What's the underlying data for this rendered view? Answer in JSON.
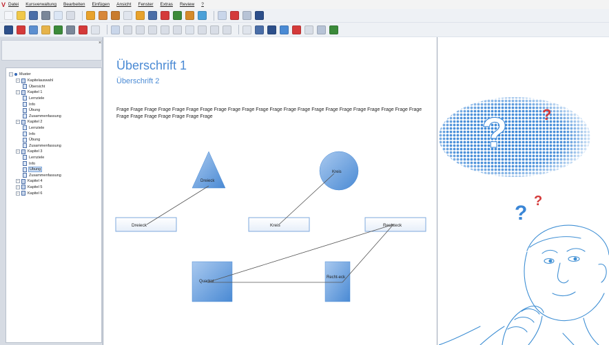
{
  "menu": {
    "logo": "V",
    "items": [
      "Datei",
      "Kursverwaltung",
      "Bearbeiten",
      "Einfügen",
      "Ansicht",
      "Fenster",
      "Extras",
      "Review",
      "?"
    ]
  },
  "toolbar": {
    "row1": [
      {
        "icon": "new-doc-icon",
        "color": "#f4f6fa"
      },
      {
        "icon": "open-folder-icon",
        "color": "#f0c84a"
      },
      {
        "icon": "save-icon",
        "color": "#4a6ea8"
      },
      {
        "icon": "print-icon",
        "color": "#7a8799"
      },
      {
        "icon": "copy-icon",
        "color": "#dbe6f5"
      },
      {
        "icon": "paste-icon",
        "color": "#d8dde6"
      },
      {
        "icon": "sep"
      },
      {
        "icon": "page-icon",
        "color": "#e8a22c"
      },
      {
        "icon": "page-edit-icon",
        "color": "#d7873a"
      },
      {
        "icon": "page-settings-icon",
        "color": "#c87b2e"
      },
      {
        "icon": "page-link-icon",
        "color": "#e0e5ee"
      },
      {
        "icon": "page-new-icon",
        "color": "#e8a22c"
      },
      {
        "icon": "page-save-icon",
        "color": "#4a6ea8"
      },
      {
        "icon": "page-delete-icon",
        "color": "#d43a3a"
      },
      {
        "icon": "page-export-icon",
        "color": "#3b8a3a"
      },
      {
        "icon": "page-move-icon",
        "color": "#d58a2a"
      },
      {
        "icon": "page-import-icon",
        "color": "#4aa0d8"
      },
      {
        "icon": "sep"
      },
      {
        "icon": "align-left-icon",
        "color": "#c9d6ea"
      },
      {
        "icon": "align-top-icon",
        "color": "#d43a3a"
      },
      {
        "icon": "width-icon",
        "color": "#b7c3d6"
      },
      {
        "icon": "text-cursor-icon",
        "color": "#2c4f8a"
      }
    ],
    "row2": [
      {
        "icon": "course-icon",
        "color": "#2c4f8a"
      },
      {
        "icon": "media-icon",
        "color": "#d43a3a"
      },
      {
        "icon": "image-icon",
        "color": "#5c8fd0"
      },
      {
        "icon": "sound-icon",
        "color": "#e6b34a"
      },
      {
        "icon": "shape-icon",
        "color": "#3b8a3a"
      },
      {
        "icon": "settings-icon",
        "color": "#7a8799"
      },
      {
        "icon": "chart-icon",
        "color": "#d43a3a"
      },
      {
        "icon": "frame-icon",
        "color": "#dfe4ec"
      },
      {
        "icon": "sep"
      },
      {
        "icon": "link-icon",
        "color": "#c9d6ea"
      },
      {
        "icon": "undo-icon",
        "color": "#d8dde6"
      },
      {
        "icon": "redo-icon",
        "color": "#d8dde6"
      },
      {
        "icon": "cut-icon",
        "color": "#d8dde6"
      },
      {
        "icon": "group-icon",
        "color": "#d8dde6"
      },
      {
        "icon": "ungroup-icon",
        "color": "#d8dde6"
      },
      {
        "icon": "table-icon",
        "color": "#dde3ec"
      },
      {
        "icon": "layers-icon",
        "color": "#d8dde6"
      },
      {
        "icon": "bring-front-icon",
        "color": "#d8dde6"
      },
      {
        "icon": "send-back-icon",
        "color": "#d8dde6"
      },
      {
        "icon": "sep"
      },
      {
        "icon": "block-icon",
        "color": "#dfe4ec"
      },
      {
        "icon": "link-chain-icon",
        "color": "#4a6ea8"
      },
      {
        "icon": "view-icon",
        "color": "#2c4f8a"
      },
      {
        "icon": "grid-icon",
        "color": "#4a8ad4"
      },
      {
        "icon": "layout-icon",
        "color": "#d43a3a"
      },
      {
        "icon": "find-icon",
        "color": "#d8dde6"
      },
      {
        "icon": "list-icon",
        "color": "#b7c3d6"
      },
      {
        "icon": "chart-bar-icon",
        "color": "#3b8a3a"
      }
    ]
  },
  "tree": {
    "root": "Muster",
    "chapters": [
      {
        "label": "Kapitelauswahl",
        "children": [
          "Übersicht"
        ]
      },
      {
        "label": "Kapitel 1",
        "children": [
          "Lernziele",
          "Info",
          "Übung",
          "Zusammenfassung"
        ]
      },
      {
        "label": "Kapitel 2",
        "children": [
          "Lernziele",
          "Info",
          "Übung",
          "Zusammenfassung"
        ]
      },
      {
        "label": "Kapitel 3",
        "children": [
          "Lernziele",
          "Info",
          "Übung",
          "Zusammenfassung"
        ]
      },
      {
        "label": "Kapitel 4",
        "children": []
      },
      {
        "label": "Kapitel 5",
        "children": []
      },
      {
        "label": "Kapitel 6",
        "children": []
      }
    ],
    "selected": "Kapitel 3 / Übung"
  },
  "document": {
    "heading1": "Überschrift 1",
    "heading2": "Überschrift 2",
    "question": "Frage Frage Frage Frage Frage Frage Frage Frage Frage Frage Frage Frage Frage Frage Frage Frage Frage Frage Frage Frage Frage Frage Frage Frage Frage Frage Frage Frage Frage",
    "shapes": {
      "triangle": "Dreieck",
      "circle": "Kreis",
      "square": "Quadrat",
      "rectangle": "Recht-eck"
    },
    "answer_boxes": [
      "Dreieck",
      "Kreis",
      "Rechteck"
    ]
  },
  "illustration": {
    "question_marks": [
      "?",
      "?",
      "?",
      "?"
    ]
  },
  "colors": {
    "accent": "#4a8ad4",
    "shape_fill": "#4a8ad4",
    "shape_fill_light": "#a9c9ef",
    "red": "#d43a3a"
  }
}
